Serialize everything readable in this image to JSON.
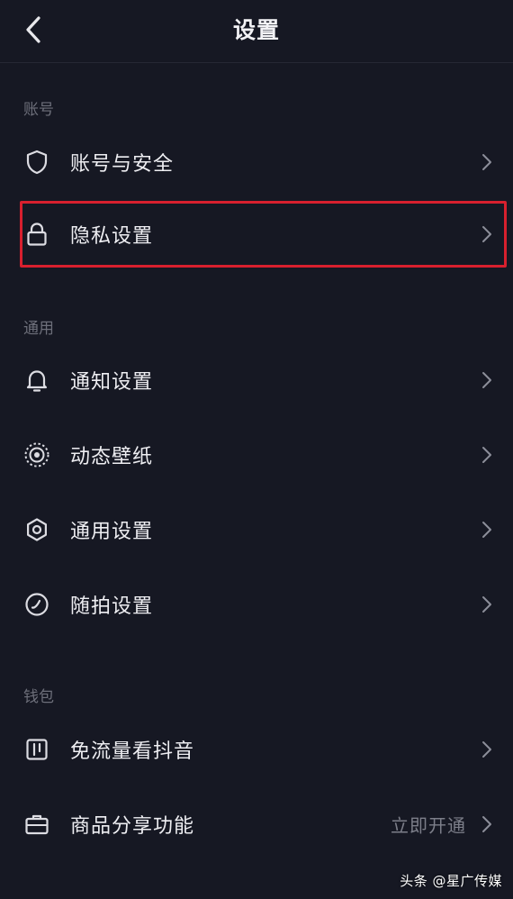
{
  "header": {
    "title": "设置",
    "back_icon": "chevron-left-icon"
  },
  "sections": {
    "account": {
      "label": "账号",
      "items": [
        {
          "label": "账号与安全",
          "icon": "shield-icon"
        },
        {
          "label": "隐私设置",
          "icon": "lock-icon",
          "highlighted": true
        }
      ]
    },
    "general": {
      "label": "通用",
      "items": [
        {
          "label": "通知设置",
          "icon": "bell-icon"
        },
        {
          "label": "动态壁纸",
          "icon": "wallpaper-icon"
        },
        {
          "label": "通用设置",
          "icon": "gear-icon"
        },
        {
          "label": "随拍设置",
          "icon": "check-circle-icon"
        }
      ]
    },
    "wallet": {
      "label": "钱包",
      "items": [
        {
          "label": "免流量看抖音",
          "icon": "data-free-icon"
        },
        {
          "label": "商品分享功能",
          "icon": "briefcase-icon",
          "value": "立即开通"
        }
      ]
    }
  },
  "watermark": "头条 @星广传媒",
  "colors": {
    "background": "#161823",
    "text": "#eeeef2",
    "muted": "#6d6f7a",
    "highlight": "#d8202e"
  }
}
